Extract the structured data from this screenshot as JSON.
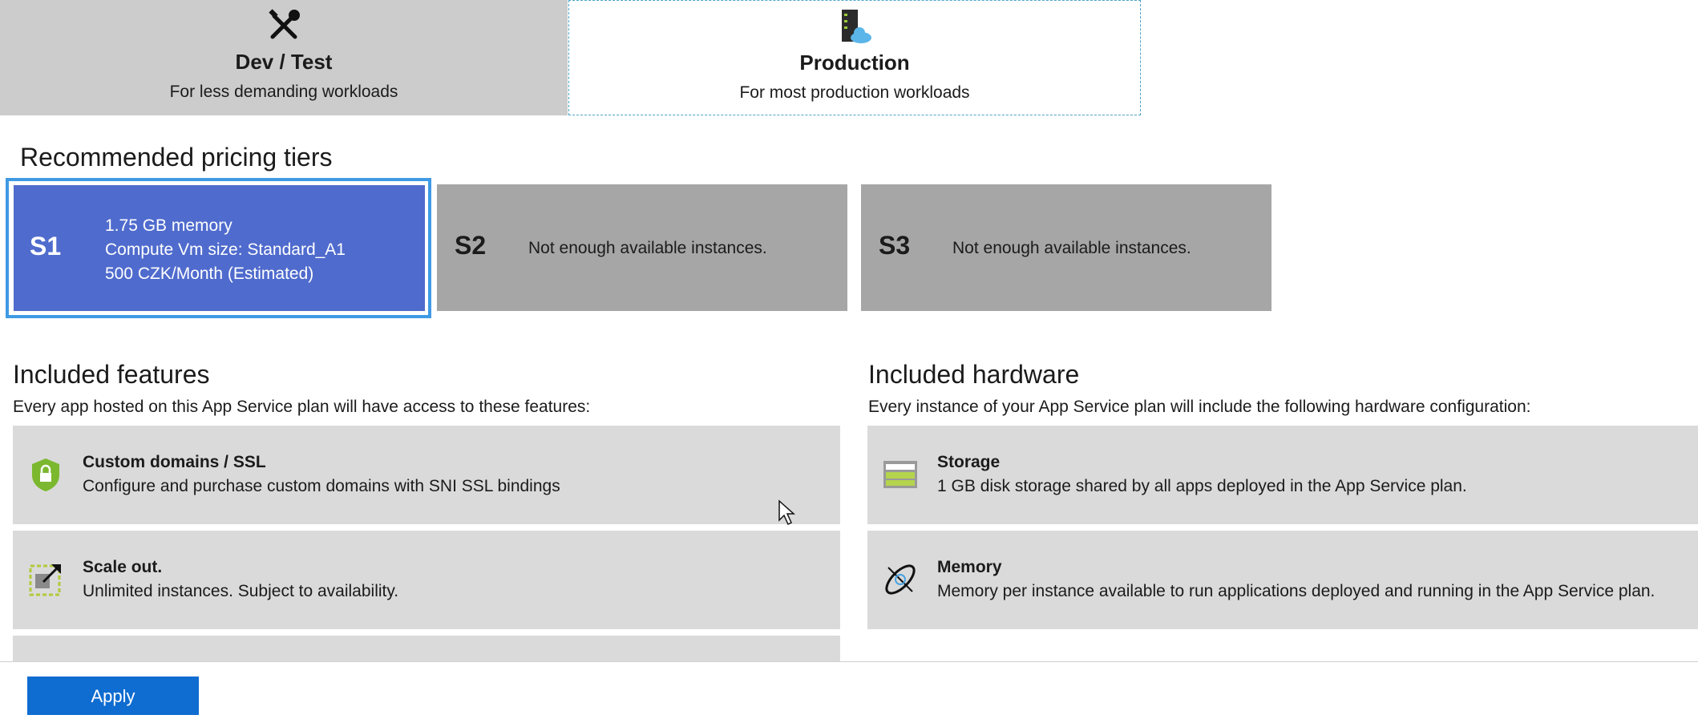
{
  "tabs": [
    {
      "title": "Dev / Test",
      "subtitle": "For less demanding workloads",
      "icon": "tools-icon"
    },
    {
      "title": "Production",
      "subtitle": "For most production workloads",
      "icon": "server-cloud-icon"
    }
  ],
  "pricing": {
    "heading": "Recommended pricing tiers",
    "tiers": [
      {
        "code": "S1",
        "lines": [
          "1.75 GB memory",
          "Compute Vm size: Standard_A1",
          "500 CZK/Month (Estimated)"
        ],
        "selected": true
      },
      {
        "code": "S2",
        "message": "Not enough available instances."
      },
      {
        "code": "S3",
        "message": "Not enough available instances."
      }
    ]
  },
  "features": {
    "heading": "Included features",
    "description": "Every app hosted on this App Service plan will have access to these features:",
    "items": [
      {
        "title": "Custom domains / SSL",
        "description": "Configure and purchase custom domains with SNI SSL bindings",
        "icon": "shield-lock-icon"
      },
      {
        "title": "Scale out.",
        "description": "Unlimited instances. Subject to availability.",
        "icon": "scale-out-icon"
      }
    ]
  },
  "hardware": {
    "heading": "Included hardware",
    "description": "Every instance of your App Service plan will include the following hardware configuration:",
    "items": [
      {
        "title": "Storage",
        "description": "1 GB disk storage shared by all apps deployed in the App Service plan.",
        "icon": "storage-icon"
      },
      {
        "title": "Memory",
        "description": "Memory per instance available to run applications deployed and running in the App Service plan.",
        "icon": "memory-icon"
      }
    ]
  },
  "footer": {
    "apply_label": "Apply"
  },
  "colors": {
    "selected_tier": "#4f6bcd",
    "selected_border": "#3f9ae4",
    "unavailable_tier": "#a6a6a6",
    "card_bg": "#dadada",
    "button": "#0f6cd0"
  }
}
